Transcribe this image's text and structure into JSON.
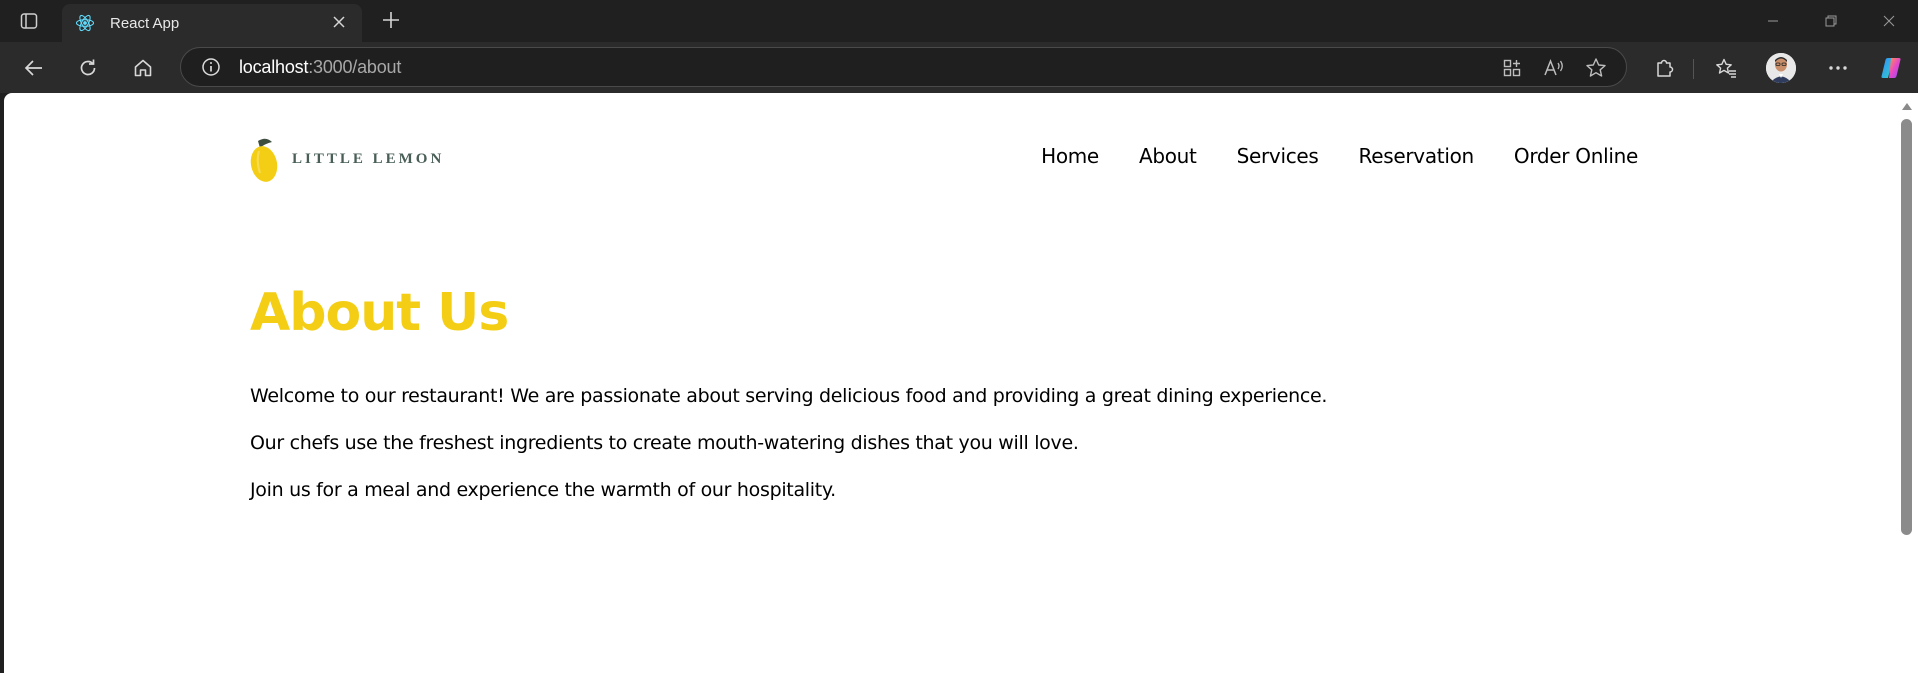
{
  "browser": {
    "tab_title": "React App",
    "url_host": "localhost",
    "url_rest": ":3000/about",
    "icons": {
      "tab_actions": "tab-actions-icon",
      "favicon": "react-icon",
      "close": "close-icon",
      "new_tab": "plus-icon",
      "back": "back-arrow-icon",
      "refresh": "refresh-icon",
      "home": "home-icon",
      "site_info": "info-icon",
      "apps": "apps-icon",
      "read_aloud": "read-aloud-icon",
      "favorite": "star-icon",
      "extensions": "puzzle-icon",
      "favorites": "favorites-icon",
      "profile": "avatar",
      "more": "more-icon",
      "copilot": "copilot-icon"
    }
  },
  "site": {
    "logo_text": "LITTLE LEMON",
    "nav": [
      {
        "label": "Home"
      },
      {
        "label": "About"
      },
      {
        "label": "Services"
      },
      {
        "label": "Reservation"
      },
      {
        "label": "Order Online"
      }
    ],
    "accent_color": "#F4CE14",
    "logo_text_color": "#495E57"
  },
  "page": {
    "title": "About Us",
    "paragraphs": [
      "Welcome to our restaurant! We are passionate about serving delicious food and providing a great dining experience.",
      "Our chefs use the freshest ingredients to create mouth-watering dishes that you will love.",
      "Join us for a meal and experience the warmth of our hospitality."
    ]
  }
}
